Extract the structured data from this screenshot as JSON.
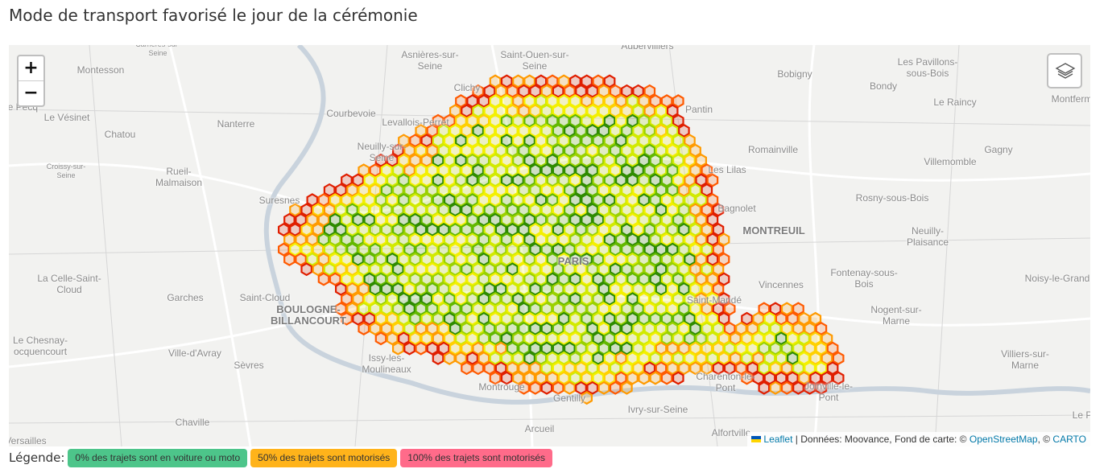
{
  "page": {
    "title": "Mode de transport favorisé le jour de la cérémonie"
  },
  "map": {
    "controls": {
      "zoom_in": "+",
      "zoom_out": "−",
      "layers_icon": "layers-icon"
    },
    "place_labels": [
      {
        "id": "carrieres",
        "text": "Carrières-sur-\nSeine"
      },
      {
        "id": "asnieres",
        "text": "Asnières-sur-\nSeine"
      },
      {
        "id": "saint-ouen",
        "text": "Saint-Ouen-sur-\nSeine"
      },
      {
        "id": "aubervilliers",
        "text": "Aubervilliers"
      },
      {
        "id": "montesson",
        "text": "Montesson"
      },
      {
        "id": "clichy",
        "text": "Clichy"
      },
      {
        "id": "bobigny",
        "text": "Bobigny"
      },
      {
        "id": "pavillons",
        "text": "Les Pavillons-\nsous-Bois"
      },
      {
        "id": "bondy",
        "text": "Bondy"
      },
      {
        "id": "le-pecq",
        "text": "Le Pecq"
      },
      {
        "id": "pantin",
        "text": "Pantin"
      },
      {
        "id": "le-raincy",
        "text": "Le Raincy"
      },
      {
        "id": "montfermeil",
        "text": "Montferm"
      },
      {
        "id": "courbevoie",
        "text": "Courbevoie"
      },
      {
        "id": "le-vesinet",
        "text": "Le Vésinet"
      },
      {
        "id": "nanterre",
        "text": "Nanterre"
      },
      {
        "id": "levallois",
        "text": "Levallois-Perret"
      },
      {
        "id": "chatou",
        "text": "Chatou"
      },
      {
        "id": "neuilly",
        "text": "Neuilly-sur-\nSeine"
      },
      {
        "id": "romainville",
        "text": "Romainville"
      },
      {
        "id": "gagny",
        "text": "Gagny"
      },
      {
        "id": "croissy",
        "text": "Croissy-sur-\nSeine"
      },
      {
        "id": "villemomble",
        "text": "Villemomble"
      },
      {
        "id": "rueil",
        "text": "Rueil-\nMalmaison"
      },
      {
        "id": "les-lilas",
        "text": "Les Lilas"
      },
      {
        "id": "suresnes",
        "text": "Suresnes"
      },
      {
        "id": "bagnolet",
        "text": "Bagnolet"
      },
      {
        "id": "rosny",
        "text": "Rosny-sous-Bois"
      },
      {
        "id": "montreuil",
        "text": "MONTREUIL"
      },
      {
        "id": "neuilly-plaisance",
        "text": "Neuilly-\nPlaisance"
      },
      {
        "id": "la-celle",
        "text": "La Celle-Saint-\nCloud"
      },
      {
        "id": "paris",
        "text": "PARIS"
      },
      {
        "id": "fontenay",
        "text": "Fontenay-sous-\nBois"
      },
      {
        "id": "noisy",
        "text": "Noisy-le-Grand"
      },
      {
        "id": "vincennes",
        "text": "Vincennes"
      },
      {
        "id": "garches",
        "text": "Garches"
      },
      {
        "id": "saint-cloud",
        "text": "Saint-Cloud"
      },
      {
        "id": "saint-mande",
        "text": "Saint-Mandé"
      },
      {
        "id": "nogent",
        "text": "Nogent-sur-\nMarne"
      },
      {
        "id": "boulogne",
        "text": "BOULOGNE-\nBILLANCOURT"
      },
      {
        "id": "le-chesnay",
        "text": "Le Chesnay-\nocquencourt"
      },
      {
        "id": "ville-davray",
        "text": "Ville-d'Avray"
      },
      {
        "id": "issy",
        "text": "Issy-les-\nMoulineaux"
      },
      {
        "id": "villiers",
        "text": "Villiers-sur-\nMarne"
      },
      {
        "id": "sevres",
        "text": "Sèvres"
      },
      {
        "id": "charenton",
        "text": "Charenton-le-\nPont"
      },
      {
        "id": "joinville",
        "text": "Joinville-le-\nPont"
      },
      {
        "id": "montrouge",
        "text": "Montrouge"
      },
      {
        "id": "gentilly",
        "text": "Gentilly"
      },
      {
        "id": "ivry",
        "text": "Ivry-sur-Seine"
      },
      {
        "id": "arcueil",
        "text": "Arcueil"
      },
      {
        "id": "chaville",
        "text": "Chaville"
      },
      {
        "id": "alfortville",
        "text": "Alfortville"
      },
      {
        "id": "versailles",
        "text": "Versailles"
      },
      {
        "id": "le-plessis",
        "text": "Le P"
      }
    ],
    "attribution": {
      "leaflet": "Leaflet",
      "data_text": " | Données: Moovance, Fond de carte: © ",
      "osm": "OpenStreetMap",
      "sep": ", © ",
      "carto": "CARTO"
    },
    "hex_color_scale": [
      "#2e8b00",
      "#63b800",
      "#9bd100",
      "#d2ea00",
      "#f4f000",
      "#ffd000",
      "#ff9a00",
      "#ff5a00",
      "#e01e00"
    ]
  },
  "legend": {
    "label": "Légende:",
    "items": [
      {
        "text": "0% des trajets sont en voiture ou moto",
        "color": "#4dc58a"
      },
      {
        "text": "50% des trajets sont motorisés",
        "color": "#ffb31a"
      },
      {
        "text": "100% des trajets sont motorisés",
        "color": "#ff6b8a"
      }
    ]
  }
}
